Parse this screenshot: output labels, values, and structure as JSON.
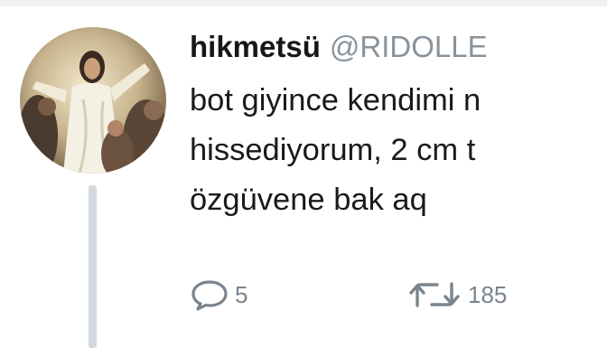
{
  "tweet": {
    "display_name": "hikmetsü",
    "handle": "@RIDOLLE",
    "text_lines": [
      "bot giyince kendimi n",
      "hissediyorum, 2 cm t",
      "özgüvene bak aq"
    ],
    "reply_count": "5",
    "retweet_count": "185"
  },
  "icons": {
    "reply": "speech-bubble",
    "retweet": "retweet-arrows"
  },
  "colors": {
    "name": "#15181b",
    "handle": "#8a939c",
    "text": "#181a1d",
    "action": "#7a848d",
    "thread_line": "#d4d9de"
  }
}
